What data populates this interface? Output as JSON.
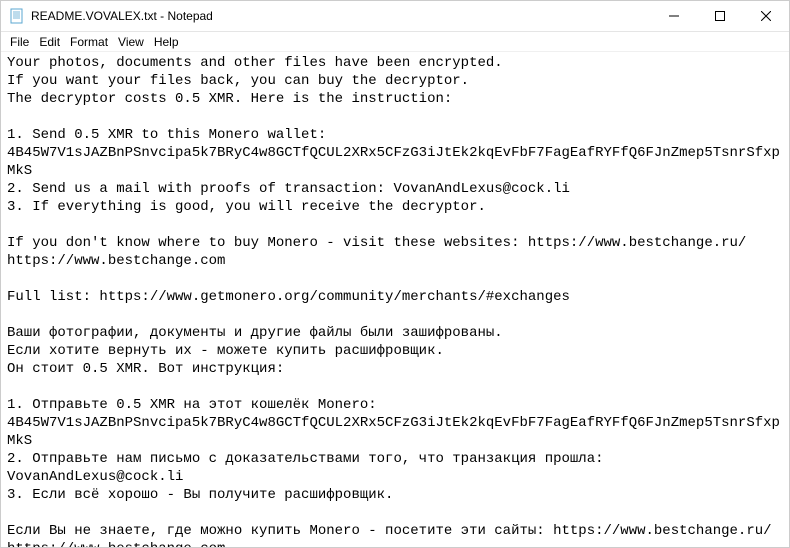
{
  "window": {
    "title": "README.VOVALEX.txt - Notepad"
  },
  "menu": {
    "file": "File",
    "edit": "Edit",
    "format": "Format",
    "view": "View",
    "help": "Help"
  },
  "content": {
    "text": "Your photos, documents and other files have been encrypted.\nIf you want your files back, you can buy the decryptor.\nThe decryptor costs 0.5 XMR. Here is the instruction:\n\n1. Send 0.5 XMR to this Monero wallet: 4B45W7V1sJAZBnPSnvcipa5k7BRyC4w8GCTfQCUL2XRx5CFzG3iJtEk2kqEvFbF7FagEafRYFfQ6FJnZmep5TsnrSfxpMkS\n2. Send us a mail with proofs of transaction: VovanAndLexus@cock.li\n3. If everything is good, you will receive the decryptor.\n\nIf you don't know where to buy Monero - visit these websites: https://www.bestchange.ru/ https://www.bestchange.com\n\nFull list: https://www.getmonero.org/community/merchants/#exchanges\n\nВаши фотографии, документы и другие файлы были зашифрованы.\nЕсли хотите вернуть их - можете купить расшифровщик.\nОн стоит 0.5 XMR. Вот инструкция:\n\n1. Отправьте 0.5 XMR на этот кошелёк Monero: 4B45W7V1sJAZBnPSnvcipa5k7BRyC4w8GCTfQCUL2XRx5CFzG3iJtEk2kqEvFbF7FagEafRYFfQ6FJnZmep5TsnrSfxpMkS\n2. Отправьте нам письмо с доказательствами того, что транзакция прошла: VovanAndLexus@cock.li\n3. Если всё хорошо - Вы получите расшифровщик.\n\nЕсли Вы не знаете, где можно купить Monero - посетите эти сайты: https://www.bestchange.ru/ https://www.bestchange.com\n\nПолный список: https://www.getmonero.org/community/merchants/#exchanges"
  }
}
